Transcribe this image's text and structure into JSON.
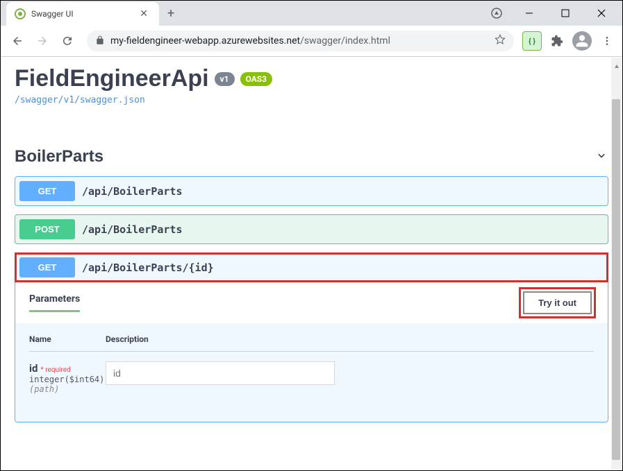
{
  "browser": {
    "tab_title": "Swagger UI",
    "url_domain": "my-fieldengineer-webapp.azurewebsites.net",
    "url_path": "/swagger/index.html"
  },
  "api": {
    "title": "FieldEngineerApi",
    "version": "v1",
    "oas": "OAS3",
    "json_link": "/swagger/v1/swagger.json"
  },
  "section": {
    "title": "BoilerParts"
  },
  "operations": [
    {
      "method": "GET",
      "path": "/api/BoilerParts"
    },
    {
      "method": "POST",
      "path": "/api/BoilerParts"
    },
    {
      "method": "GET",
      "path": "/api/BoilerParts/{id}"
    }
  ],
  "params_panel": {
    "tab_label": "Parameters",
    "try_label": "Try it out",
    "th_name": "Name",
    "th_desc": "Description",
    "param_name": "id",
    "param_required": "required",
    "param_type": "integer($int64)",
    "param_in": "(path)",
    "param_placeholder": "id"
  }
}
